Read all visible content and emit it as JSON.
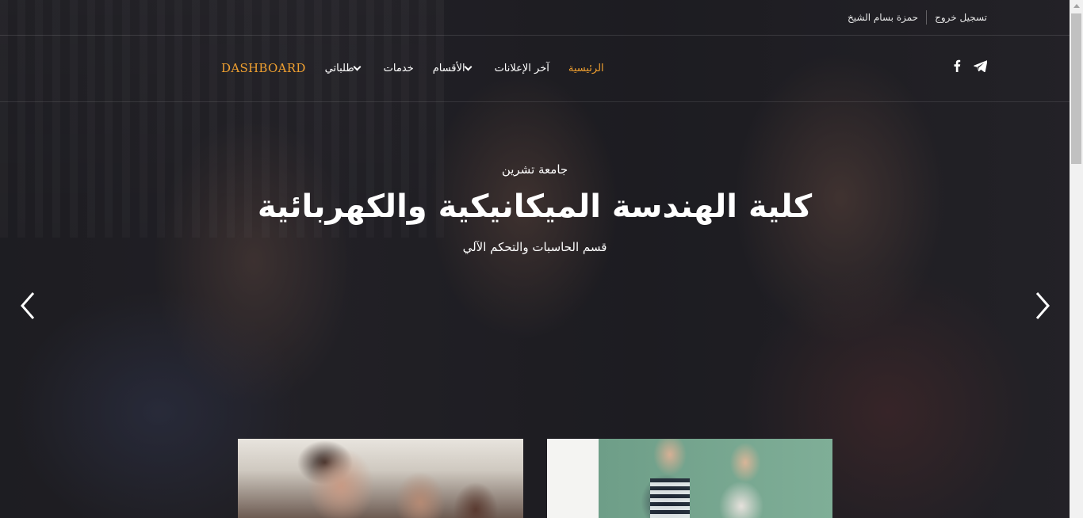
{
  "topbar": {
    "logout": "تسجيل خروج",
    "user_name": "حمزة بسام الشيخ"
  },
  "nav": {
    "home": "الرئيسية",
    "latest_ads": "آخر الإعلانات",
    "departments": "الأقسام",
    "services": "خدمات",
    "my_requests": "طلباتي",
    "dashboard": "DASHBOARD"
  },
  "social": {
    "facebook_icon": "facebook-icon",
    "telegram_icon": "telegram-icon"
  },
  "hero": {
    "university": "جامعة تشرين",
    "title": "كلية الهندسة الميكانيكية والكهربائية",
    "department": "قسم الحاسبات والتحكم الآلي"
  },
  "colors": {
    "accent": "#f0a030",
    "text": "#ffffff"
  }
}
